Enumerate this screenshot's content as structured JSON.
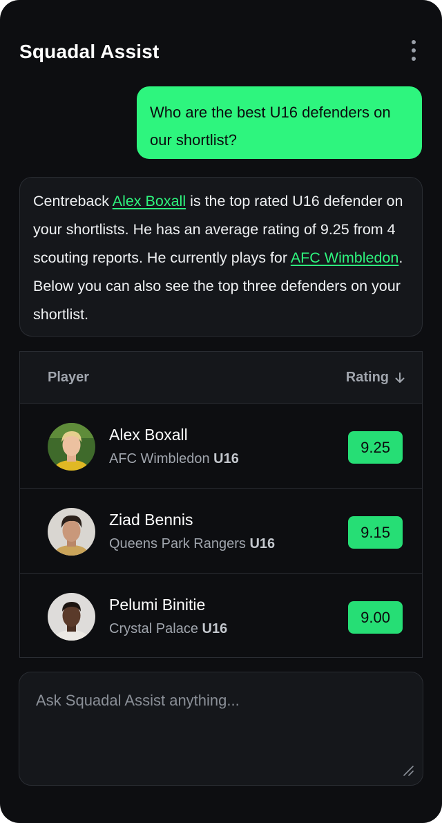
{
  "app": {
    "title": "Squadal Assist"
  },
  "chat": {
    "user_message": "Who are the best U16 defenders on our shortlist?",
    "assistant": {
      "part1": "Centreback ",
      "player_link": "Alex Boxall",
      "part2": " is the top rated U16 defender on your shortlists. He has an average rating of 9.25 from 4 scouting reports. He currently plays for ",
      "club_link": "AFC Wimbledon",
      "part3": ". Below you can also see the top three defenders on your shortlist."
    }
  },
  "table": {
    "columns": {
      "player": "Player",
      "rating": "Rating"
    },
    "sort_icon": "arrow-down-icon",
    "rows": [
      {
        "name": "Alex Boxall",
        "club": "AFC Wimbledon",
        "age_group": "U16",
        "rating": "9.25"
      },
      {
        "name": "Ziad Bennis",
        "club": "Queens Park Rangers",
        "age_group": "U16",
        "rating": "9.15"
      },
      {
        "name": "Pelumi Binitie",
        "club": "Crystal Palace",
        "age_group": "U16",
        "rating": "9.00"
      }
    ]
  },
  "composer": {
    "placeholder": "Ask Squadal Assist anything...",
    "value": ""
  },
  "colors": {
    "accent": "#2ef57e",
    "badge": "#26de75",
    "background": "#0d0e11",
    "panel": "#15171b"
  }
}
